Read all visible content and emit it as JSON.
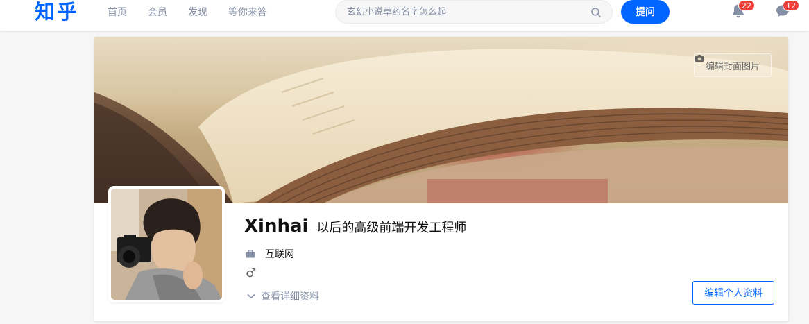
{
  "header": {
    "logo": "知乎",
    "nav": [
      "首页",
      "会员",
      "发现",
      "等你来答"
    ],
    "search_placeholder": "玄幻小说草药名字怎么起",
    "ask_label": "提问",
    "notifications_count": "22",
    "messages_count": "12"
  },
  "profile": {
    "edit_cover_label": "编辑封面图片",
    "name": "Xinhai",
    "headline": "以后的高级前端开发工程师",
    "industry": "互联网",
    "gender_symbol": "♂",
    "detail_link": "查看详细资料",
    "edit_profile_label": "编辑个人资料"
  },
  "colors": {
    "brand": "#0066ff",
    "badge": "#f1403c",
    "muted": "#8590a6"
  },
  "icons": {
    "search": "search-icon",
    "bell": "bell-icon",
    "chat": "chat-bubble-icon",
    "camera": "camera-icon",
    "briefcase": "briefcase-icon",
    "gender": "male-icon",
    "chevron": "chevron-down-icon"
  }
}
